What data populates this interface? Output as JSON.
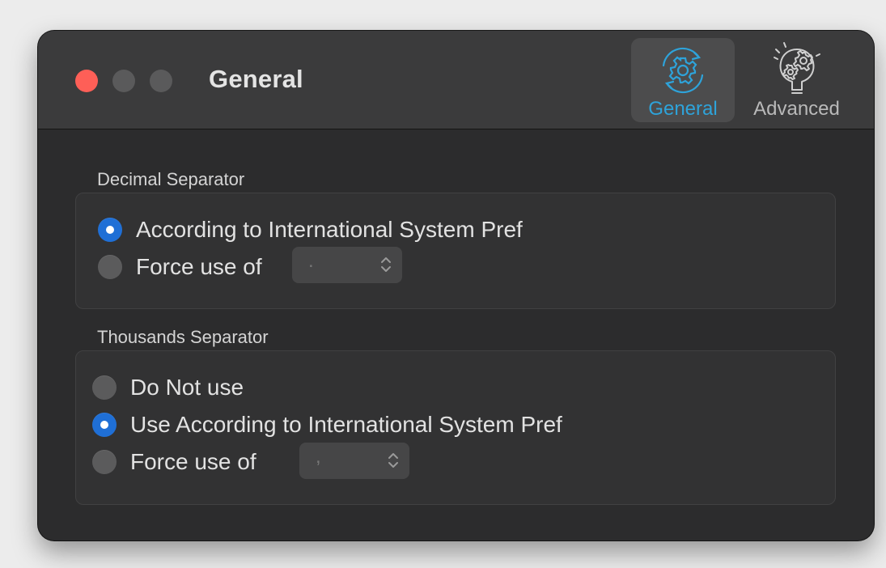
{
  "window": {
    "title": "General"
  },
  "toolbar": {
    "general_label": "General",
    "general_icon": "gear-cycle-icon",
    "advanced_label": "Advanced",
    "advanced_icon": "lightbulb-gears-icon",
    "selected": "General"
  },
  "decimal_section": {
    "title": "Decimal Separator",
    "options": [
      {
        "label": "According to International System Pref",
        "checked": true
      },
      {
        "label": "Force use of",
        "checked": false
      }
    ],
    "popup_value": ".",
    "popup_icon": "up-down-chevron-icon"
  },
  "thousands_section": {
    "title": "Thousands Separator",
    "options": [
      {
        "label": "Do Not use",
        "checked": false
      },
      {
        "label": "Use According to International System Pref",
        "checked": true
      },
      {
        "label": "Force use of",
        "checked": false
      }
    ],
    "popup_value": ",",
    "popup_icon": "up-down-chevron-icon"
  },
  "colors": {
    "accent": "#1f6fd6",
    "selected_toolbar_label": "#2ea3da",
    "close_button": "#fe5f57",
    "window_background": "#2c2c2d"
  }
}
